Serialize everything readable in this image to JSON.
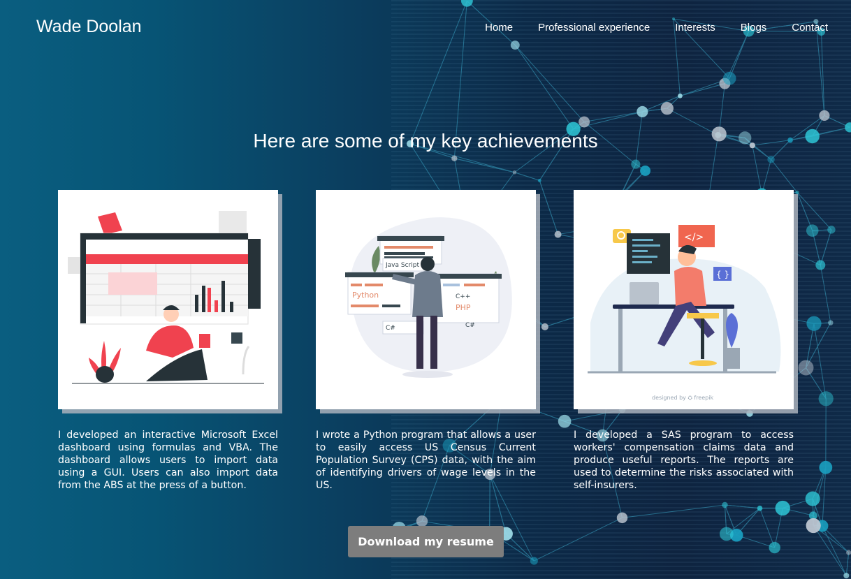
{
  "brand": "Wade Doolan",
  "nav": {
    "home": "Home",
    "experience": "Professional experience",
    "interests": "Interests",
    "blogs": "Blogs",
    "contact": "Contact"
  },
  "heading": "Here are some of my key achievements",
  "cards": [
    {
      "text": "I developed an interactive Microsoft Excel dashboard using formulas and VBA. The dashboard allows users to import data using a GUI. Users can also import data from the ABS at the press of a button."
    },
    {
      "labels": {
        "js": "Java Script",
        "python": "Python",
        "cpp": "C++",
        "php": "PHP",
        "cs1": "C#",
        "cs2": "C#"
      },
      "text": "I wrote a Python program that allows a user to easily access US Census Current Population Survey (CPS) data, with the aim of identifying drivers of wage levels in the US."
    },
    {
      "labels": {
        "code": "</>",
        "braces": "{ }",
        "credit": "designed by ⛭ freepik"
      },
      "text": "I developed a SAS program to access workers' compensation claims data and produce useful reports. The reports are used to determine the risks associated with self-insurers."
    }
  ],
  "resume_button": "Download my resume",
  "colors": {
    "accent_red": "#f0424f",
    "network_cyan": "#2ec6d6",
    "button_gray": "#7d7d7d"
  }
}
